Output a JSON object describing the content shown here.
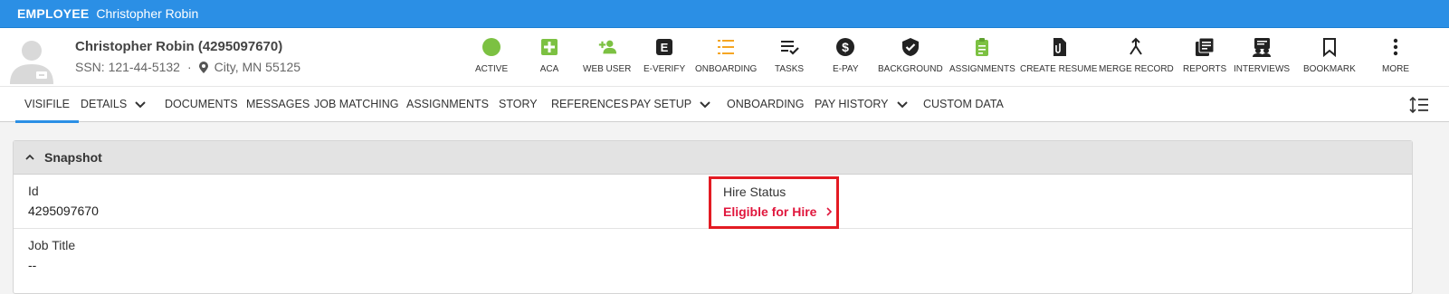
{
  "topbar": {
    "role": "EMPLOYEE",
    "name": "Christopher Robin"
  },
  "person": {
    "display_name": "Christopher Robin (4295097670)",
    "ssn": "SSN: 121-44-5132",
    "separator": "·",
    "location": "City, MN 55125"
  },
  "actions": [
    {
      "label": "ACTIVE",
      "icon": "active-status-icon",
      "color": "#7cc142"
    },
    {
      "label": "ACA",
      "icon": "plus-box-icon",
      "color": "#7cc142"
    },
    {
      "label": "WEB USER",
      "icon": "add-user-icon",
      "color": "#7cc142"
    },
    {
      "label": "E-VERIFY",
      "icon": "e-verify-icon",
      "color": "#222222"
    },
    {
      "label": "ONBOARDING",
      "icon": "checklist-icon",
      "color": "#f5a623"
    },
    {
      "label": "TASKS",
      "icon": "tasks-icon",
      "color": "#222222"
    },
    {
      "label": "E-PAY",
      "icon": "dollar-icon",
      "color": "#222222"
    },
    {
      "label": "BACKGROUND",
      "icon": "shield-check-icon",
      "color": "#222222"
    },
    {
      "label": "ASSIGNMENTS",
      "icon": "clipboard-icon",
      "color": "#7cc142"
    },
    {
      "label": "CREATE RESUME",
      "icon": "attach-document-icon",
      "color": "#222222"
    },
    {
      "label": "MERGE RECORD",
      "icon": "merge-icon",
      "color": "#222222"
    },
    {
      "label": "REPORTS",
      "icon": "reports-icon",
      "color": "#222222"
    },
    {
      "label": "INTERVIEWS",
      "icon": "interviews-icon",
      "color": "#222222"
    },
    {
      "label": "BOOKMARK",
      "icon": "bookmark-icon",
      "color": "#222222"
    },
    {
      "label": "MORE",
      "icon": "more-vertical-icon",
      "color": "#222222"
    }
  ],
  "tabs": [
    {
      "label": "VISIFILE",
      "active": true
    },
    {
      "label": "DETAILS"
    },
    {
      "label": "DOCUMENTS"
    },
    {
      "label": "MESSAGES"
    },
    {
      "label": "JOB MATCHING"
    },
    {
      "label": "ASSIGNMENTS"
    },
    {
      "label": "STORY"
    },
    {
      "label": "REFERENCES"
    },
    {
      "label": "PAY SETUP"
    },
    {
      "label": "ONBOARDING"
    },
    {
      "label": "PAY HISTORY"
    },
    {
      "label": "CUSTOM DATA"
    }
  ],
  "snapshot": {
    "title": "Snapshot",
    "id_label": "Id",
    "id_value": "4295097670",
    "hire_label": "Hire Status",
    "hire_value": "Eligible for Hire",
    "job_title_label": "Job Title",
    "job_title_value": "--"
  },
  "colors": {
    "accent": "#2b8fe5",
    "hire_highlight": "#e31b23",
    "hire_text": "#e0173d",
    "green": "#7cc142"
  }
}
